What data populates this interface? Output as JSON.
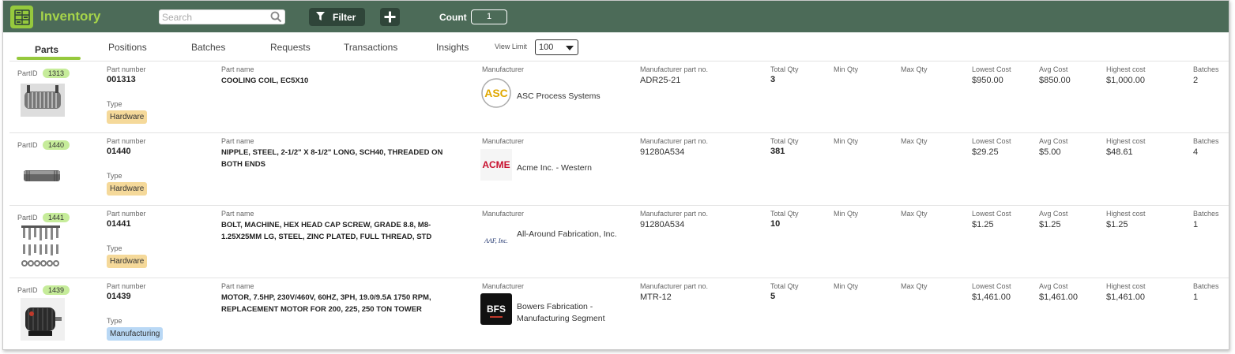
{
  "header": {
    "title": "Inventory",
    "search_placeholder": "Search",
    "filter_label": "Filter",
    "count_label": "Count",
    "count_value": "1"
  },
  "tabs": [
    {
      "label": "Parts",
      "active": true
    },
    {
      "label": "Positions"
    },
    {
      "label": "Batches"
    },
    {
      "label": "Requests"
    },
    {
      "label": "Transactions"
    },
    {
      "label": "Insights"
    }
  ],
  "view_limit": {
    "label": "View Limit",
    "value": "100"
  },
  "columns": {
    "part_id": "PartID",
    "part_number": "Part number",
    "type": "Type",
    "part_name": "Part name",
    "manufacturer": "Manufacturer",
    "mfr_part_no": "Manufacturer part no.",
    "total_qty": "Total Qty",
    "min_qty": "Min Qty",
    "max_qty": "Max Qty",
    "lowest_cost": "Lowest Cost",
    "avg_cost": "Avg Cost",
    "highest_cost": "Highest cost",
    "batches": "Batches"
  },
  "rows": [
    {
      "part_id": "1313",
      "part_number": "001313",
      "type": "Hardware",
      "type_color": "#f5d99a",
      "part_name": "COOLING COIL, EC5X10",
      "manufacturer": "ASC Process Systems",
      "mfr_part_no": "ADR25-21",
      "total_qty": "3",
      "lowest_cost": "$950.00",
      "avg_cost": "$850.00",
      "highest_cost": "$1,000.00",
      "batches": "2",
      "thumb_icon": "cooling-coil-image",
      "logo_icon": "asc-logo",
      "logo_text": "ASC"
    },
    {
      "part_id": "1440",
      "part_number": "01440",
      "type": "Hardware",
      "type_color": "#f5d99a",
      "part_name": "NIPPLE, STEEL, 2-1/2\" X 8-1/2\" LONG, SCH40, THREADED ON BOTH ENDS",
      "manufacturer": "Acme Inc. - Western",
      "mfr_part_no": "91280A534",
      "total_qty": "381",
      "lowest_cost": "$29.25",
      "avg_cost": "$5.00",
      "highest_cost": "$48.61",
      "batches": "4",
      "thumb_icon": "steel-nipple-image",
      "logo_icon": "acme-logo",
      "logo_text": "ACME"
    },
    {
      "part_id": "1441",
      "part_number": "01441",
      "type": "Hardware",
      "type_color": "#f5d99a",
      "part_name": "BOLT, MACHINE, HEX HEAD CAP SCREW, GRADE 8.8, M8-1.25X25MM LG, STEEL,  ZINC PLATED, FULL THREAD, STD",
      "manufacturer": "All-Around Fabrication, Inc.",
      "mfr_part_no": "91280A534",
      "total_qty": "10",
      "lowest_cost": "$1.25",
      "avg_cost": "$1.25",
      "highest_cost": "$1.25",
      "batches": "1",
      "thumb_icon": "bolts-image",
      "logo_icon": "aaf-logo",
      "logo_text": "AAF, Inc."
    },
    {
      "part_id": "1439",
      "part_number": "01439",
      "type": "Manufacturing",
      "type_color": "#b9d8f5",
      "part_name": "MOTOR, 7.5HP, 230V/460V, 60HZ, 3PH, 19.0/9.5A 1750 RPM, REPLACEMENT MOTOR FOR 200, 225, 250 TON TOWER",
      "manufacturer": "Bowers Fabrication - Manufacturing Segment",
      "mfr_part_no": "MTR-12",
      "total_qty": "5",
      "lowest_cost": "$1,461.00",
      "avg_cost": "$1,461.00",
      "highest_cost": "$1,461.00",
      "batches": "1",
      "thumb_icon": "motor-image",
      "logo_icon": "bfs-logo",
      "logo_text": "BFS"
    }
  ]
}
